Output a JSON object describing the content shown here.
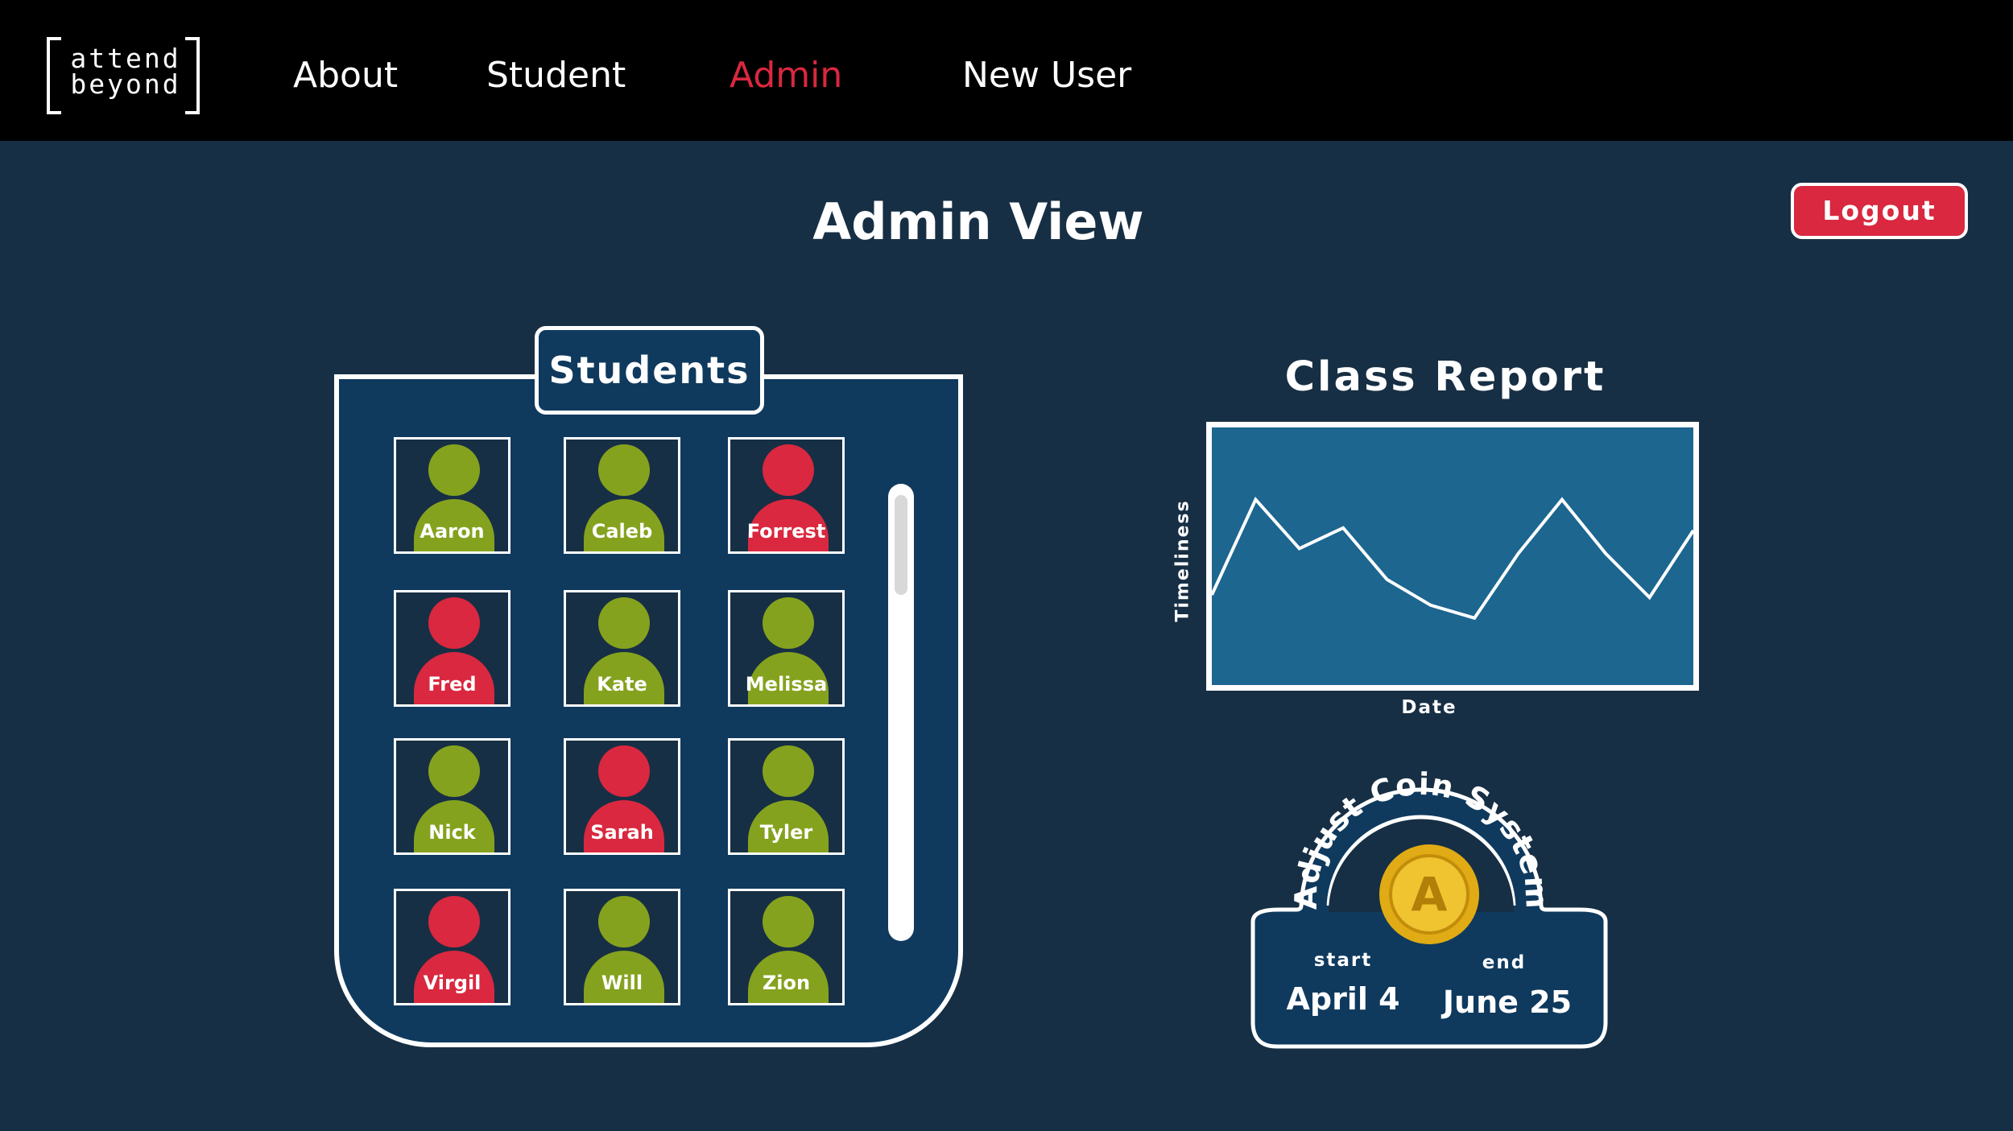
{
  "brand": {
    "line1": "attend",
    "line2": "beyond"
  },
  "nav": {
    "items": [
      {
        "label": "About"
      },
      {
        "label": "Student"
      },
      {
        "label": "Admin",
        "active": true
      },
      {
        "label": "New User"
      }
    ]
  },
  "page": {
    "title": "Admin View",
    "logout_label": "Logout"
  },
  "students": {
    "panel_title": "Students",
    "list": [
      {
        "name": "Aaron",
        "status": "present"
      },
      {
        "name": "Caleb",
        "status": "present"
      },
      {
        "name": "Forrest",
        "status": "absent"
      },
      {
        "name": "Fred",
        "status": "absent"
      },
      {
        "name": "Kate",
        "status": "present"
      },
      {
        "name": "Melissa",
        "status": "present"
      },
      {
        "name": "Nick",
        "status": "present"
      },
      {
        "name": "Sarah",
        "status": "absent"
      },
      {
        "name": "Tyler",
        "status": "present"
      },
      {
        "name": "Virgil",
        "status": "absent"
      },
      {
        "name": "Will",
        "status": "present"
      },
      {
        "name": "Zion",
        "status": "present"
      }
    ]
  },
  "report": {
    "title": "Class Report"
  },
  "chart_data": {
    "type": "line",
    "title": "Class Report",
    "xlabel": "Date",
    "ylabel": "Timeliness",
    "x": [
      0,
      1,
      2,
      3,
      4,
      5,
      6,
      7,
      8,
      9,
      10,
      11
    ],
    "values": [
      0.35,
      0.72,
      0.53,
      0.61,
      0.41,
      0.31,
      0.26,
      0.51,
      0.72,
      0.51,
      0.34,
      0.6
    ],
    "ylim": [
      0,
      1
    ],
    "grid": false,
    "line_color": "#ffffff",
    "fill_color": "#1c6690"
  },
  "coin_system": {
    "label": "Adjust Coin System",
    "coin_letter": "A",
    "start_label": "start",
    "start_value": "April 4",
    "end_label": "end",
    "end_value": "June 25"
  },
  "colors": {
    "background": "#172f44",
    "panel": "#0f3a5e",
    "accent_red": "#d9283f",
    "present_green": "#85a21e",
    "chart_fill": "#1c6690",
    "coin_gold": "#d6a416"
  }
}
